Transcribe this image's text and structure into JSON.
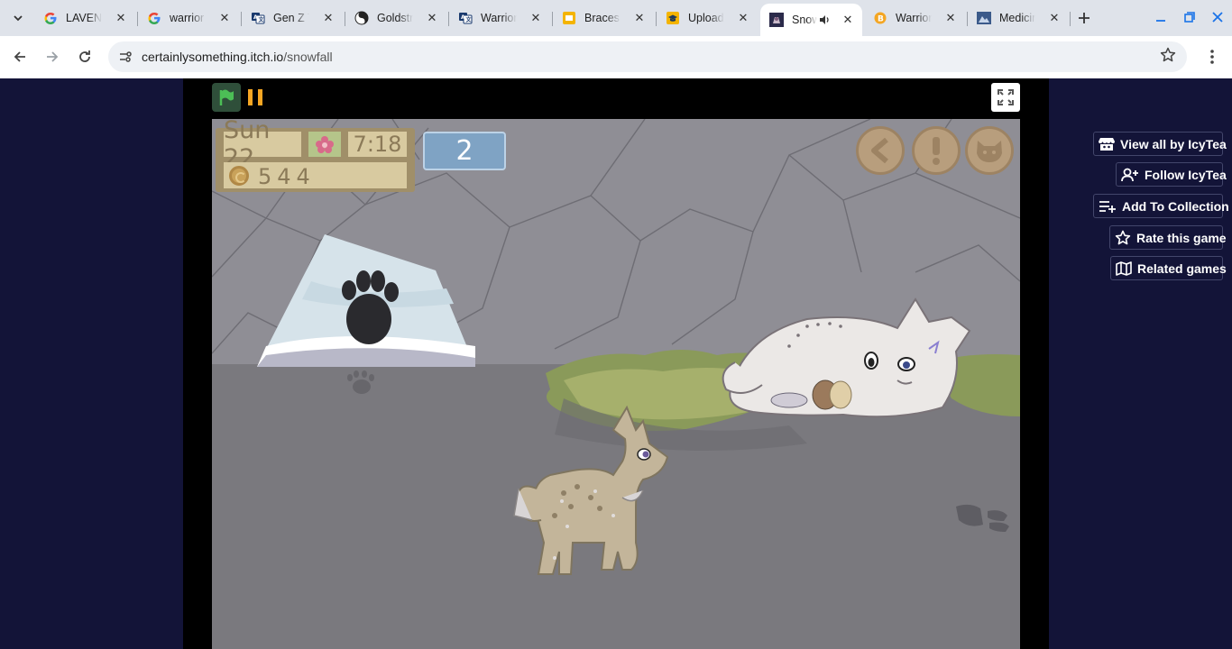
{
  "browser": {
    "tabs": [
      {
        "title": "LAVENDER",
        "favicon": "G",
        "favicon_color": "#4285f4",
        "active": false
      },
      {
        "title": "warrior cats",
        "favicon": "G",
        "favicon_color": "#4285f4",
        "active": false
      },
      {
        "title": "Gen Z Translator",
        "favicon": "translate-icon",
        "favicon_color": "#1a3a6e",
        "active": false
      },
      {
        "title": "Goldstripe",
        "favicon": "swirl-icon",
        "favicon_color": "#222222",
        "active": false
      },
      {
        "title": "Warriors",
        "favicon": "translate-icon",
        "favicon_color": "#1a3a6e",
        "active": false
      },
      {
        "title": "Braces & Retainers",
        "favicon": "slides-icon",
        "favicon_color": "#f4b400",
        "active": false
      },
      {
        "title": "Upload",
        "favicon": "cap-icon",
        "favicon_color": "#f4b400",
        "active": false
      },
      {
        "title": "Snowfall",
        "favicon": "game-icon",
        "favicon_color": "#2b2a4a",
        "active": true,
        "audio": true
      },
      {
        "title": "Warriors",
        "favicon": "coin-icon",
        "favicon_color": "#f4a623",
        "active": false
      },
      {
        "title": "Medicine cat",
        "favicon": "image-icon",
        "favicon_color": "#3b5a8a",
        "active": false
      }
    ],
    "url_domain": "certainlysomething.itch.io",
    "url_path": "/snowfall"
  },
  "game": {
    "hud": {
      "day": "Sun 22",
      "time": "7:18",
      "money": "544",
      "counter": "2"
    },
    "icons": {
      "flag": "green-flag-icon",
      "pause": "pause-icon",
      "fullscreen": "fullscreen-icon",
      "back": "back-arrow-icon",
      "alert": "exclamation-icon",
      "cat": "cat-face-icon"
    }
  },
  "sidebar": {
    "buttons": [
      {
        "label": "View all by IcyTea",
        "icon": "itchio-store-icon"
      },
      {
        "label": "Follow IcyTea",
        "icon": "follow-user-icon"
      },
      {
        "label": "Add To Collection",
        "icon": "playlist-add-icon"
      },
      {
        "label": "Rate this game",
        "icon": "star-icon"
      },
      {
        "label": "Related games",
        "icon": "map-icon"
      }
    ]
  },
  "colors": {
    "page_bg": "#131438",
    "game_bg": "#000000",
    "stage_wall": "#8f8e95",
    "stage_floor": "#7a797e",
    "counter_bg": "#7fa3c4"
  }
}
